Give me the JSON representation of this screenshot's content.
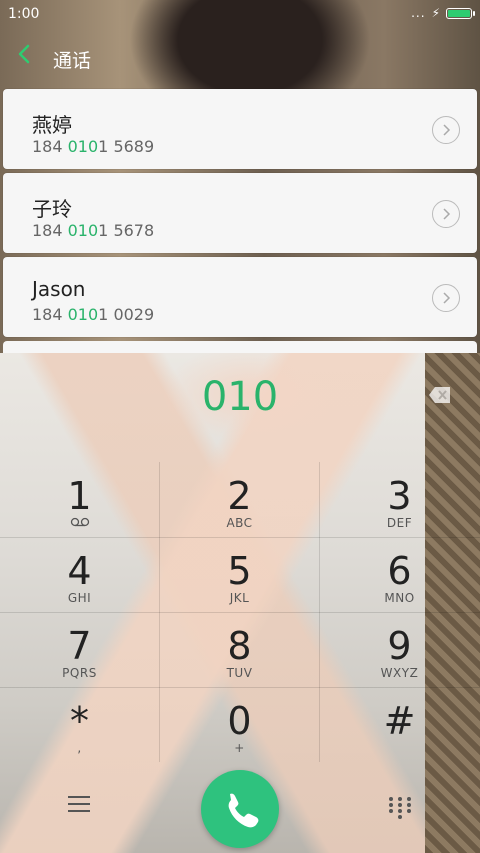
{
  "status": {
    "time": "1:00",
    "dots": "...",
    "battery_level": 1.0
  },
  "header": {
    "title": "通话"
  },
  "contacts": [
    {
      "name": "燕婷",
      "number_prefix": "184 ",
      "number_match": "010",
      "number_suffix": "1 5689"
    },
    {
      "name": "子玲",
      "number_prefix": "184 ",
      "number_match": "010",
      "number_suffix": "1 5678"
    },
    {
      "name": "Jason",
      "number_prefix": "184 ",
      "number_match": "010",
      "number_suffix": "1 0029"
    }
  ],
  "dialer": {
    "input": "010",
    "keys": [
      {
        "digit": "1",
        "letters": ""
      },
      {
        "digit": "2",
        "letters": "ABC"
      },
      {
        "digit": "3",
        "letters": "DEF"
      },
      {
        "digit": "4",
        "letters": "GHI"
      },
      {
        "digit": "5",
        "letters": "JKL"
      },
      {
        "digit": "6",
        "letters": "MNO"
      },
      {
        "digit": "7",
        "letters": "PQRS"
      },
      {
        "digit": "8",
        "letters": "TUV"
      },
      {
        "digit": "9",
        "letters": "WXYZ"
      },
      {
        "digit": "*",
        "letters": ","
      },
      {
        "digit": "0",
        "letters": "+"
      },
      {
        "digit": "#",
        "letters": ""
      }
    ]
  },
  "colors": {
    "accent": "#2ab36b",
    "call_button": "#2ec27e"
  },
  "icons": {
    "back": "chevron-left-icon",
    "backspace": "backspace-icon",
    "call": "phone-icon",
    "menu": "menu-icon",
    "keypad": "dialpad-icon",
    "voicemail": "voicemail-icon"
  }
}
